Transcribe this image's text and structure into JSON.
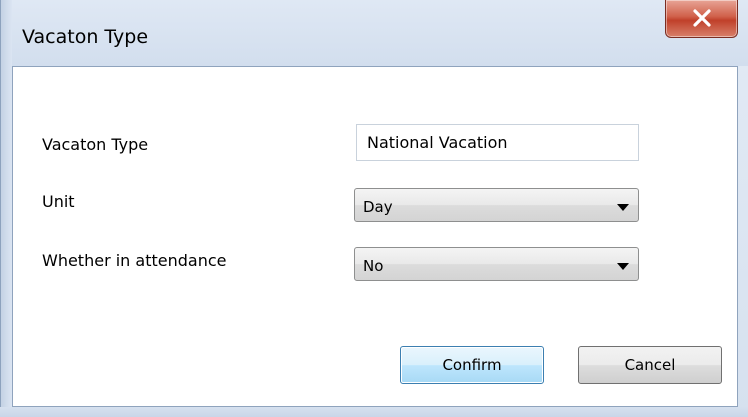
{
  "window": {
    "title": "Vacaton Type"
  },
  "form": {
    "vacation_type": {
      "label": "Vacaton Type",
      "value": "National Vacation"
    },
    "unit": {
      "label": "Unit",
      "selected": "Day"
    },
    "attendance": {
      "label": "Whether in attendance",
      "selected": "No"
    }
  },
  "buttons": {
    "confirm": "Confirm",
    "cancel": "Cancel"
  },
  "icons": {
    "close": "close-icon",
    "dropdown": "chevron-down-icon"
  },
  "colors": {
    "close_button": "#c9452e",
    "default_button_border": "#3c7fb1",
    "client_background": "#ffffff"
  }
}
